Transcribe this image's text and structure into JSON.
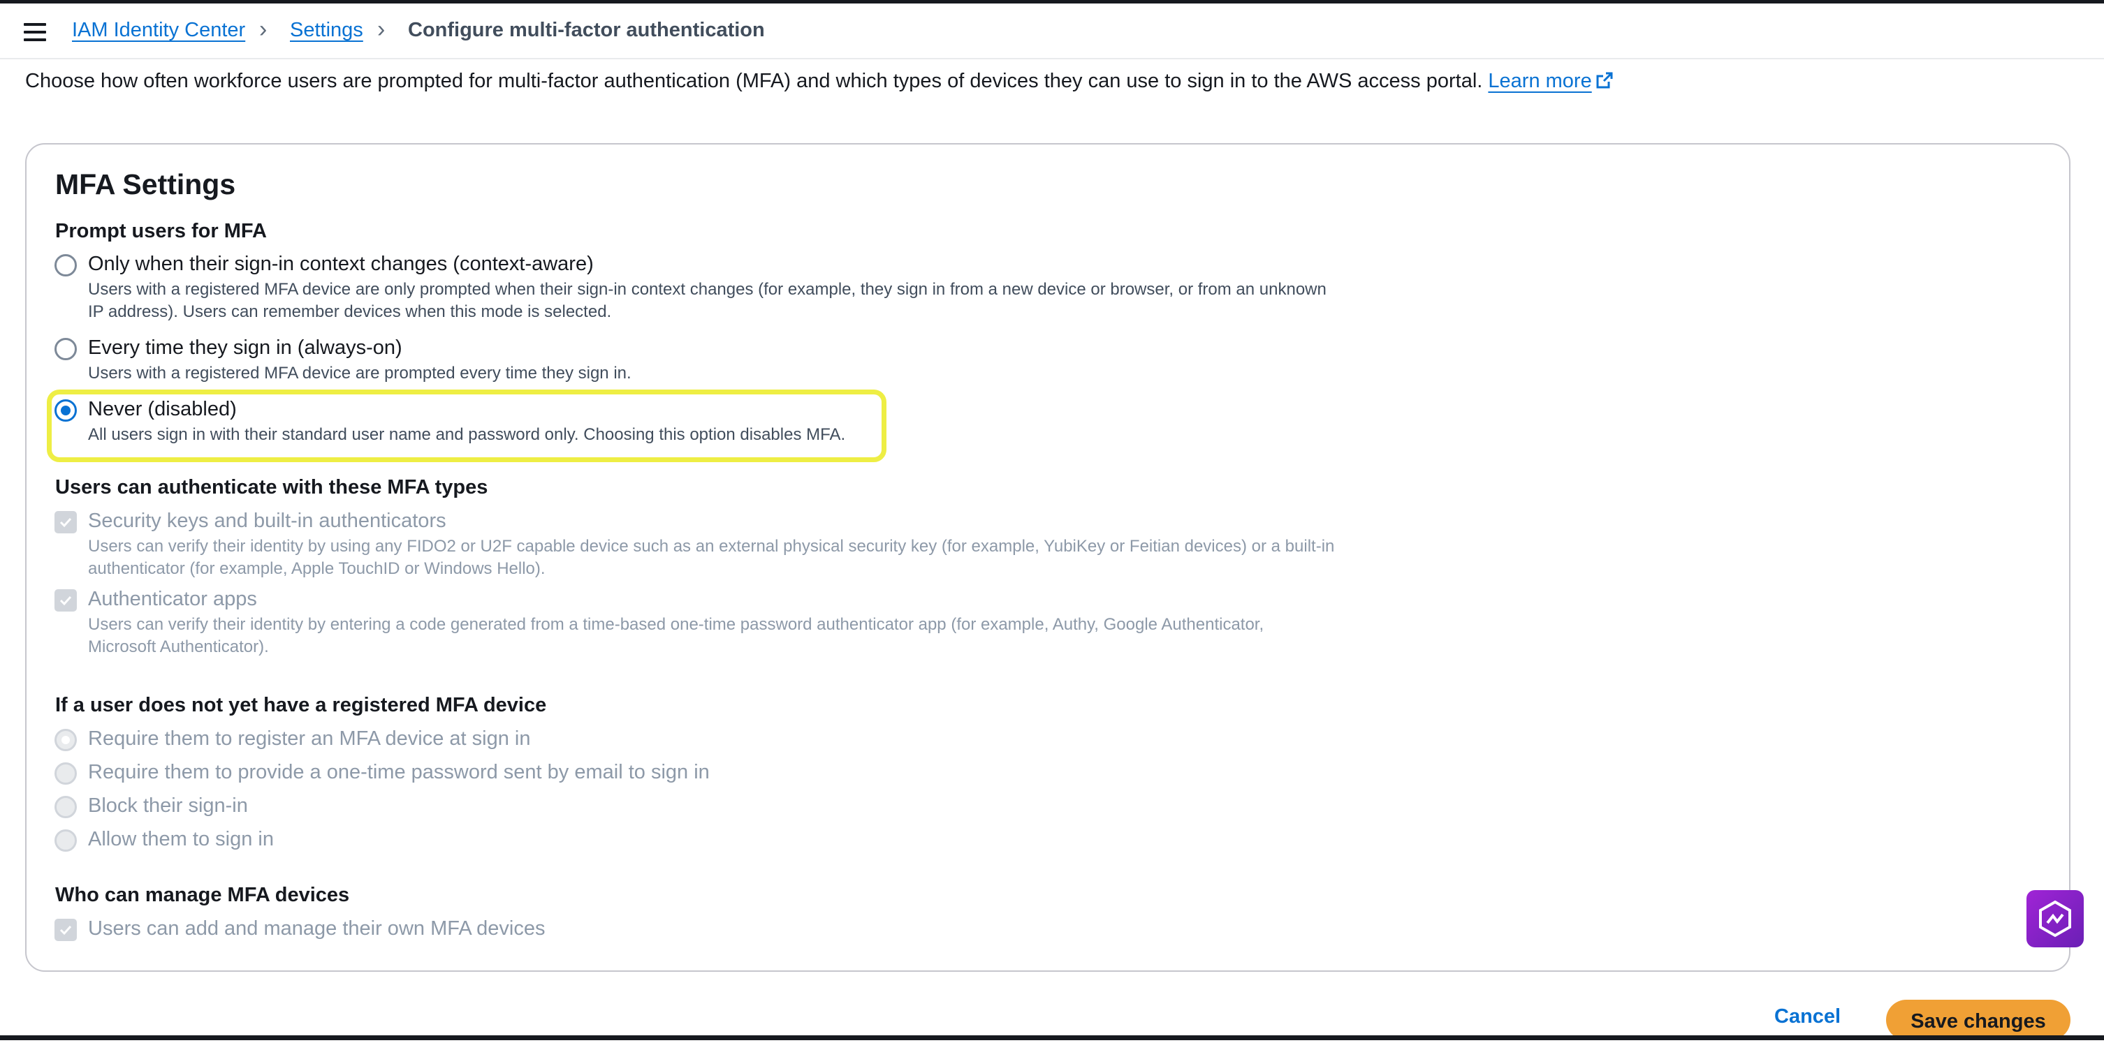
{
  "colors": {
    "link": "#0972d3",
    "primary_button": "#f0a035",
    "highlight": "#eeee44",
    "text": "#16191f",
    "muted_text": "#8d99a8",
    "widget": "#8a22c8"
  },
  "header": {
    "menu_icon": "hamburger-menu-icon",
    "breadcrumbs": [
      "IAM Identity Center",
      "Settings",
      "Configure multi-factor authentication"
    ],
    "separator_icon": "chevron-right-icon"
  },
  "description": {
    "text": "Choose how often workforce users are prompted for multi-factor authentication (MFA) and which types of devices they can use to sign in to the AWS access portal.",
    "link": "Learn more",
    "link_icon": "external-link-icon"
  },
  "card": {
    "title": "MFA Settings",
    "prompt_section": {
      "label": "Prompt users for MFA",
      "selected": "Never (disabled)",
      "options": [
        {
          "label": "Only when their sign-in context changes (context-aware)",
          "description_line1": "Users with a registered MFA device are only prompted when their sign-in context changes (for example, they sign in from a new device or browser, or from an unknown",
          "description_line2": "IP address). Users can remember devices when this mode is selected."
        },
        {
          "label": "Every time they sign in (always-on)",
          "description_line1": "Users with a registered MFA device are prompted every time they sign in."
        },
        {
          "label": "Never (disabled)",
          "description_line1": "All users sign in with their standard user name and password only. Choosing this option disables MFA."
        }
      ]
    },
    "types_section": {
      "label": "Users can authenticate with these MFA types",
      "options": [
        {
          "label": "Security keys and built-in authenticators",
          "checked": true,
          "disabled": true,
          "description_line1": "Users can verify their identity by using any FIDO2 or U2F capable device such as an external physical security key (for example, YubiKey or Feitian devices) or a built-in",
          "description_line2": "authenticator (for example, Apple TouchID or Windows Hello)."
        },
        {
          "label": "Authenticator apps",
          "checked": true,
          "disabled": true,
          "description_line1": "Users can verify their identity by entering a code generated from a time-based one-time password authenticator app (for example, Authy, Google Authenticator,",
          "description_line2": "Microsoft Authenticator)."
        }
      ]
    },
    "no_device_section": {
      "label": "If a user does not yet have a registered MFA device",
      "selected": "Require them to register an MFA device at sign in",
      "options": [
        "Require them to register an MFA device at sign in",
        "Require them to provide a one-time password sent by email to sign in",
        "Block their sign-in",
        "Allow them to sign in"
      ]
    },
    "manage_section": {
      "label": "Who can manage MFA devices",
      "option": "Users can add and manage their own MFA devices",
      "checked": true,
      "disabled": true
    }
  },
  "footer": {
    "cancel_label": "Cancel",
    "save_label": "Save changes"
  },
  "widget_icon": "assistant-app-icon"
}
